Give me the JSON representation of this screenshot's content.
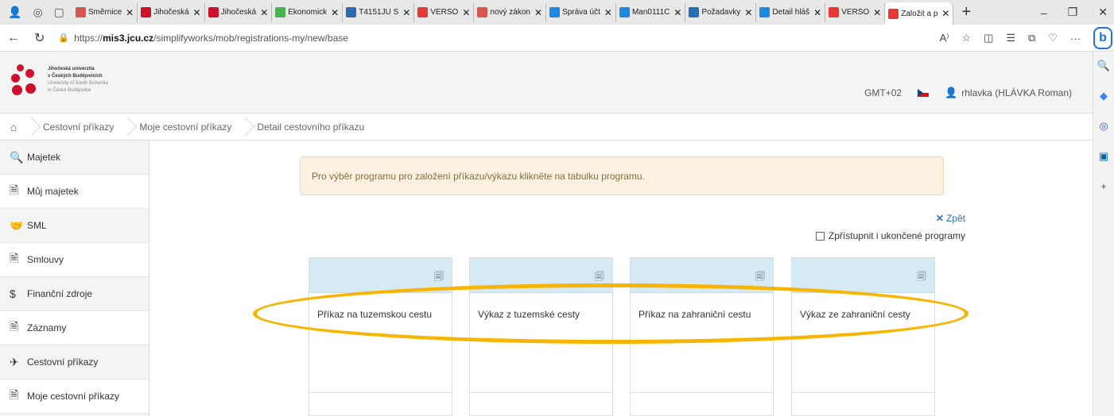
{
  "browser": {
    "tabs": [
      {
        "label": "Směrnice",
        "color": "#d9534f"
      },
      {
        "label": "Jihočeská",
        "color": "#d0112b"
      },
      {
        "label": "Jihočeská",
        "color": "#d0112b"
      },
      {
        "label": "Ekonomick",
        "color": "#4caf50"
      },
      {
        "label": "T4151JU S",
        "color": "#2b6cb0"
      },
      {
        "label": "VERSO",
        "color": "#e53935"
      },
      {
        "label": "nový zákon",
        "color": "#d9534f"
      },
      {
        "label": "Správa účt",
        "color": "#1e88e5"
      },
      {
        "label": "Man0111C",
        "color": "#1e88e5"
      },
      {
        "label": "Požadavky",
        "color": "#2b6cb0"
      },
      {
        "label": "Detail hláš",
        "color": "#1e88e5"
      },
      {
        "label": "VERSO",
        "color": "#e53935"
      },
      {
        "label": "Založit a p",
        "color": "#e53935"
      }
    ],
    "url_prefix": "https://",
    "url_host": "mis3.jcu.cz",
    "url_path": "/simplifyworks/mob/registrations-my/new/base"
  },
  "header": {
    "logo_lines": [
      "Jihočeská univerzita",
      "v Českých Budějovicích",
      "University of South Bohemia",
      "in České Budějovice"
    ],
    "timezone": "GMT+02",
    "user": "rhlavka (HLÁVKA Roman)"
  },
  "breadcrumb": [
    "Cestovní příkazy",
    "Moje cestovní příkazy",
    "Detail cestovního příkazu"
  ],
  "menu": [
    {
      "label": "Majetek",
      "icon": "magnifier-icon",
      "glyph": "🔍",
      "sub": false
    },
    {
      "label": "Můj majetek",
      "icon": "document-icon",
      "glyph": "🗎",
      "sub": true
    },
    {
      "label": "SML",
      "icon": "handshake-icon",
      "glyph": "🤝",
      "sub": false
    },
    {
      "label": "Smlouvy",
      "icon": "document-icon",
      "glyph": "🗎",
      "sub": true
    },
    {
      "label": "Finanční zdroje",
      "icon": "dollar-icon",
      "glyph": "$",
      "sub": false
    },
    {
      "label": "Záznamy",
      "icon": "document-icon",
      "glyph": "🗎",
      "sub": true
    },
    {
      "label": "Cestovní příkazy",
      "icon": "travel-icon",
      "glyph": "✈",
      "sub": false
    },
    {
      "label": "Moje cestovní příkazy",
      "icon": "document-icon",
      "glyph": "🗎",
      "sub": true
    }
  ],
  "alert": "Pro výběr programu pro založení příkazu/výkazu klikněte na tabulku programu.",
  "back_label": "Zpět",
  "show_ended_label": "Zpřístupnit i ukončené programy",
  "programs": [
    "Příkaz na tuzemskou cestu",
    "Výkaz z tuzemské cesty",
    "Příkaz na zahraniční cestu",
    "Výkaz ze zahraniční cesty"
  ],
  "colors": {
    "brand_red": "#d0112b",
    "alert_bg": "#fcf1e1",
    "card_head": "#d6eaf6",
    "highlight": "#f7b500",
    "link": "#2a6ebb"
  }
}
